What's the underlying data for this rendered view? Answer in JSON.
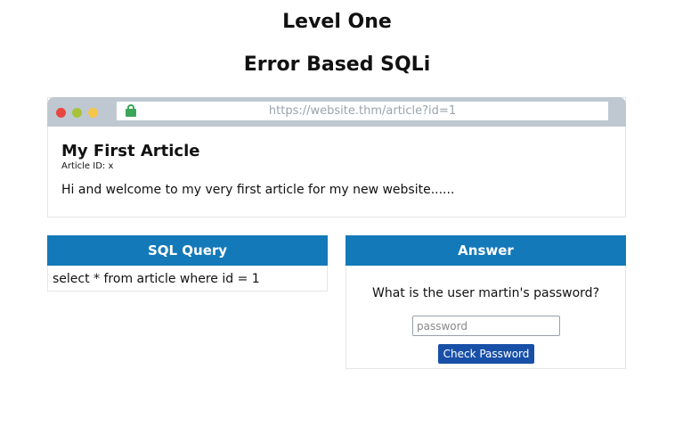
{
  "header": {
    "title": "Level One",
    "subtitle": "Error Based SQLi"
  },
  "browser": {
    "url": "https://website.thm/article?id=1",
    "article": {
      "title": "My First Article",
      "id_label": "Article ID: x",
      "body": "Hi and welcome to my very first article for my new website......"
    }
  },
  "sql_panel": {
    "heading": "SQL Query",
    "query": "select * from article where id = 1"
  },
  "answer_panel": {
    "heading": "Answer",
    "question": "What is the user martin's password?",
    "password_placeholder": "password",
    "password_value": "",
    "button_label": "Check Password"
  },
  "colors": {
    "panel_header": "#1479b8",
    "button": "#1850a8",
    "browser_bar": "#bfc8d1",
    "lock": "#3da55a"
  },
  "icons": [
    "lock-icon"
  ]
}
